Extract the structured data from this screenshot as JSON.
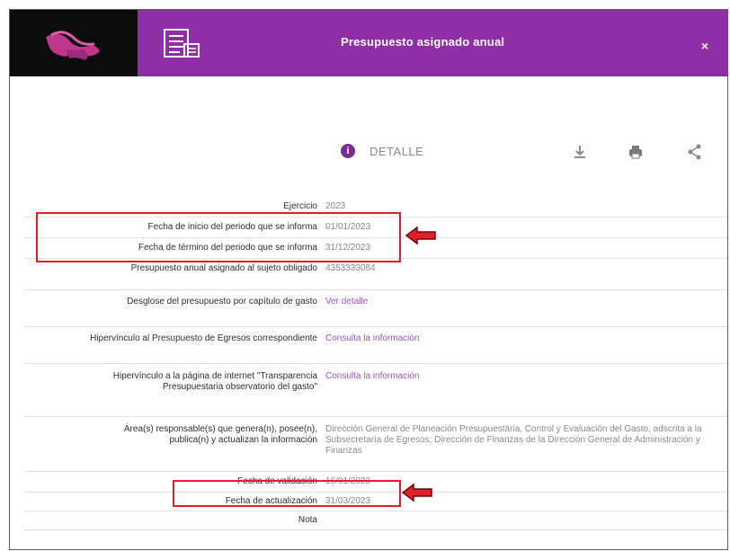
{
  "header": {
    "title": "Presupuesto asignado anual",
    "close_label": "×"
  },
  "detail": {
    "label": "DETALLE",
    "info_symbol": "i"
  },
  "rows": [
    {
      "label": "Ejercicio",
      "value": "2023"
    },
    {
      "label": "Fecha de inicio del periodo que se informa",
      "value": "01/01/2023"
    },
    {
      "label": "Fecha de término del periodo que se informa",
      "value": "31/12/2023"
    },
    {
      "label": "Presupuesto anual asignado al sujeto obligado",
      "value": "4353333084"
    },
    {
      "label": "Desglose del presupuesto por capítulo de gasto",
      "value": "Ver detalle"
    },
    {
      "label": "Hipervínculo al Presupuesto de Egresos correspondiente",
      "value": "Consulta la información"
    },
    {
      "label": "Hipervínculo a la página de internet \"Transparencia Presupuestaria observatorio del gasto\"",
      "value": "Consulta la información"
    },
    {
      "label": "Área(s) responsable(s) que genera(n), posee(n), publica(n) y actualizan la información",
      "value": "Dirección General de Planeación Presupuestaria, Control y Evaluación del Gasto, adscrita a la Subsecretaría de Egresos; Dirección de Finanzas de la Dirección General de Administración y Finanzas"
    },
    {
      "label": "Fecha de validación",
      "value": "16/01/2023"
    },
    {
      "label": "Fecha de actualización",
      "value": "31/03/2023"
    },
    {
      "label": "Nota",
      "value": ""
    }
  ],
  "colors": {
    "purple": "#8e2fa8",
    "highlight_red": "#e01f2a",
    "link": "#9b59b6"
  },
  "icons": [
    "mexico-logo-icon",
    "document-list-icon",
    "close-icon",
    "info-icon",
    "download-icon",
    "print-icon",
    "share-icon",
    "red-arrow-icon"
  ]
}
